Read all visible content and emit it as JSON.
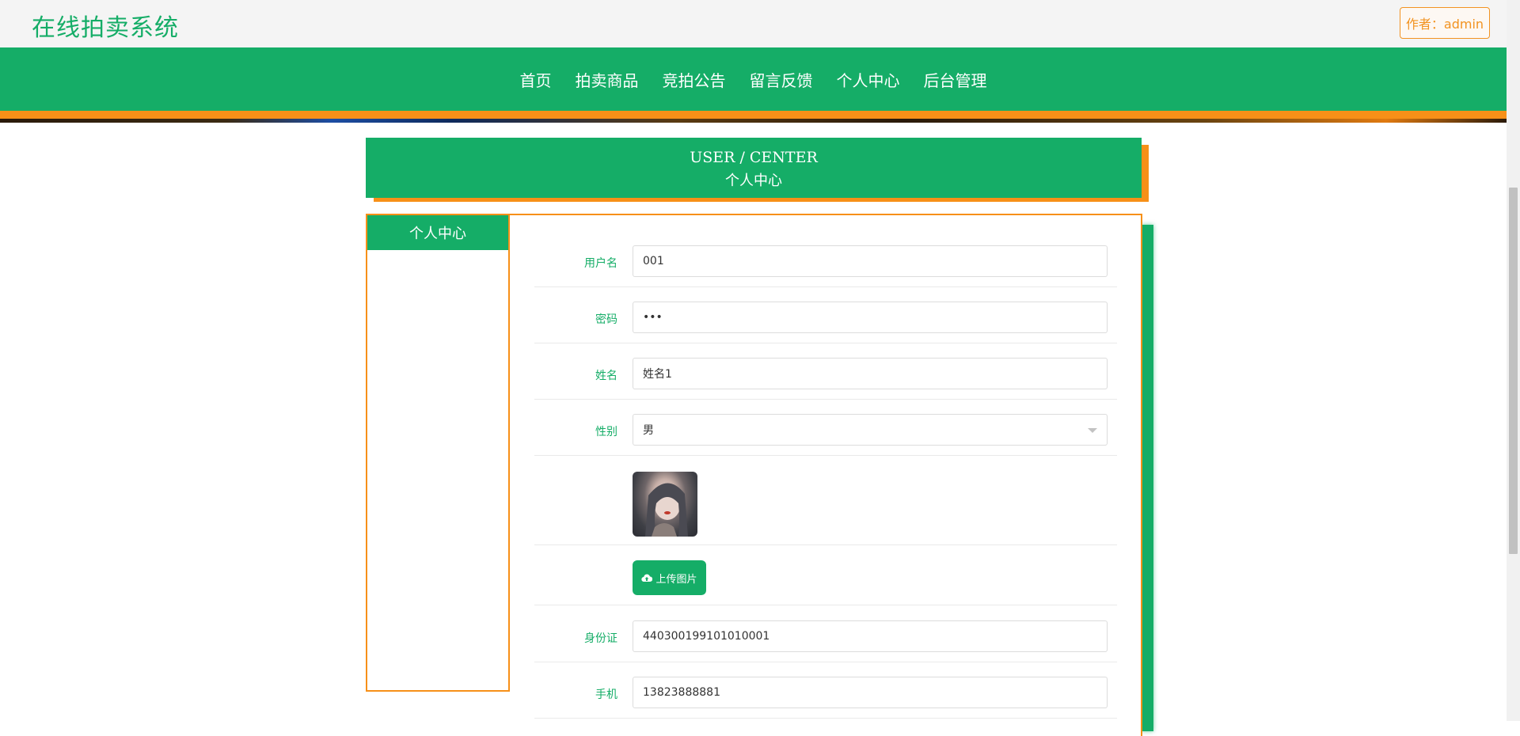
{
  "header": {
    "site_title": "在线拍卖系统",
    "author_label": "作者：admin"
  },
  "nav": {
    "items": [
      "首页",
      "拍卖商品",
      "竞拍公告",
      "留言反馈",
      "个人中心",
      "后台管理"
    ]
  },
  "section": {
    "title_en": "USER / CENTER",
    "title_cn": "个人中心"
  },
  "sidebar": {
    "title": "个人中心"
  },
  "form": {
    "username_label": "用户名",
    "username_value": "001",
    "password_label": "密码",
    "password_value": "•••",
    "name_label": "姓名",
    "name_value": "姓名1",
    "gender_label": "性别",
    "gender_value": "男",
    "upload_label": "上传图片",
    "id_label": "身份证",
    "id_value": "440300199101010001",
    "phone_label": "手机",
    "phone_value": "13823888881"
  },
  "icons": {
    "upload": "cloud-upload-icon",
    "select": "chevron-down-icon"
  },
  "colors": {
    "primary": "#15ad67",
    "accent": "#f79018"
  }
}
